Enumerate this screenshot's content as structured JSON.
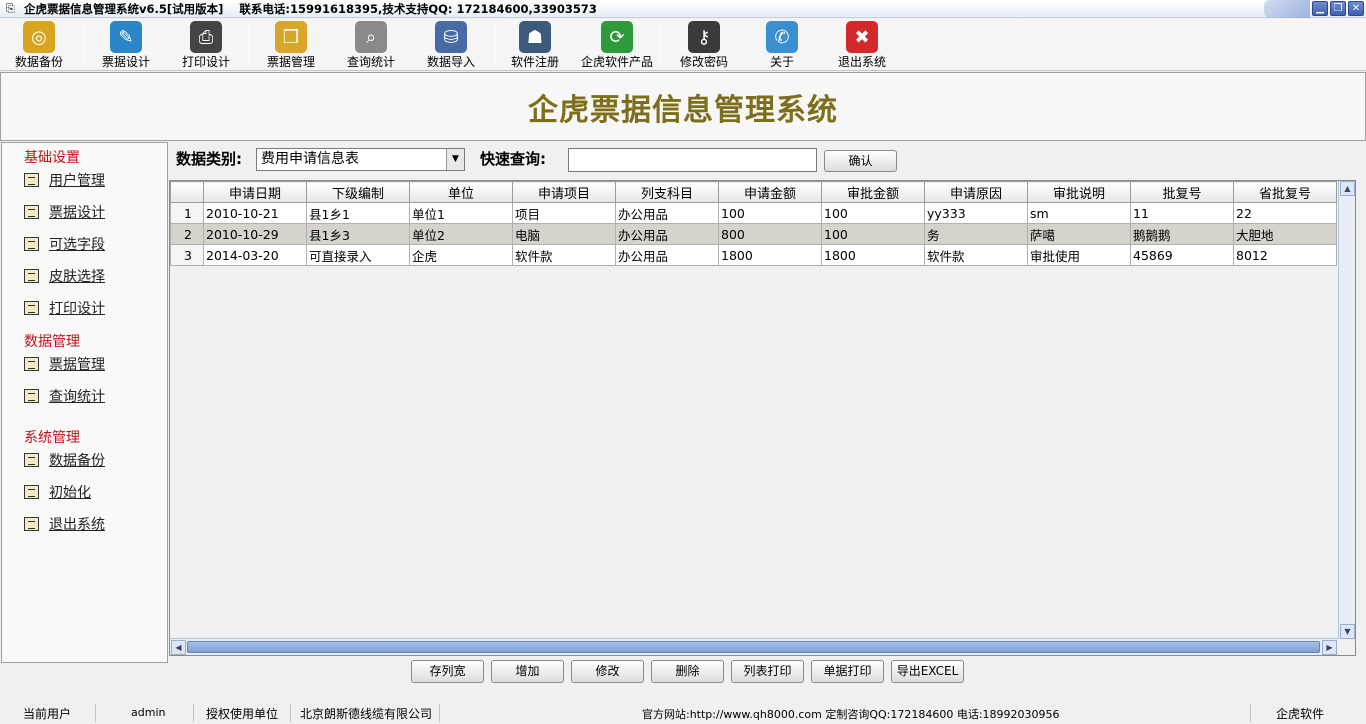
{
  "titlebar": {
    "title": "企虎票据信息管理系统v6.5[试用版本]",
    "contact": "联系电话:15991618395,技术支持QQ: 172184600,33903573",
    "minimize": "▁",
    "restore": "❐",
    "close": "✕"
  },
  "toolbar": {
    "items": [
      {
        "label": "数据备份",
        "icon": "database-backup-icon",
        "color": "#d9a520"
      },
      {
        "label": "票据设计",
        "icon": "design-icon",
        "color": "#2b86c9"
      },
      {
        "label": "打印设计",
        "icon": "printer-icon",
        "color": "#444444"
      },
      {
        "label": "票据管理",
        "icon": "folder-icon",
        "color": "#d7a62a"
      },
      {
        "label": "查询统计",
        "icon": "magnifier-icon",
        "color": "#8a8a8a"
      },
      {
        "label": "数据导入",
        "icon": "database-import-icon",
        "color": "#4a6aa6"
      },
      {
        "label": "软件注册",
        "icon": "register-icon",
        "color": "#3c5a7a"
      },
      {
        "label": "企虎软件产品",
        "icon": "refresh-icon",
        "color": "#2f9a3a"
      },
      {
        "label": "修改密码",
        "icon": "key-icon",
        "color": "#3a3a3a"
      },
      {
        "label": "关于",
        "icon": "about-icon",
        "color": "#3a8fd0"
      },
      {
        "label": "退出系统",
        "icon": "exit-icon",
        "color": "#d22a2a"
      }
    ]
  },
  "banner": {
    "title": "企虎票据信息管理系统"
  },
  "sidebar": {
    "groups": [
      {
        "title": "基础设置",
        "items": [
          "用户管理",
          "票据设计",
          "可选字段",
          "皮肤选择",
          "打印设计"
        ]
      },
      {
        "title": "数据管理",
        "items": [
          "票据管理",
          "查询统计"
        ]
      },
      {
        "title": "系统管理",
        "items": [
          "数据备份",
          "初始化",
          "退出系统"
        ]
      }
    ]
  },
  "query": {
    "category_label": "数据类别:",
    "category_value": "费用申请信息表",
    "quick_label": "快速查询:",
    "quick_value": "",
    "confirm": "确认"
  },
  "grid": {
    "columns": [
      "申请日期",
      "下级编制",
      "单位",
      "申请项目",
      "列支科目",
      "申请金额",
      "审批金额",
      "申请原因",
      "审批说明",
      "批复号",
      "省批复号"
    ],
    "rows": [
      {
        "n": "1",
        "cells": [
          "2010-10-21",
          "县1乡1",
          "单位1",
          "项目",
          "办公用品",
          "100",
          "100",
          "yy333",
          "sm",
          "11",
          "22"
        ]
      },
      {
        "n": "2",
        "cells": [
          "2010-10-29",
          "县1乡3",
          "单位2",
          "电脑",
          "办公用品",
          "800",
          "100",
          "务",
          "萨噶",
          "鹅鹅鹅",
          "大胆地"
        ]
      },
      {
        "n": "3",
        "cells": [
          "2014-03-20",
          "可直接录入",
          "企虎",
          "软件款",
          "办公用品",
          "1800",
          "1800",
          "软件款",
          "审批使用",
          "45869",
          "8012"
        ]
      }
    ],
    "selected_row": 1
  },
  "actions": [
    "存列宽",
    "增加",
    "修改",
    "删除",
    "列表打印",
    "单据打印",
    "导出EXCEL"
  ],
  "status": {
    "user_label": "当前用户",
    "user_value": "admin",
    "auth_label": "授权使用单位",
    "auth_value": "北京朗斯德线缆有限公司",
    "site": "官方网站:http://www.qh8000.com 定制咨询QQ:172184600 电话:18992030956",
    "brand": "企虎软件"
  }
}
